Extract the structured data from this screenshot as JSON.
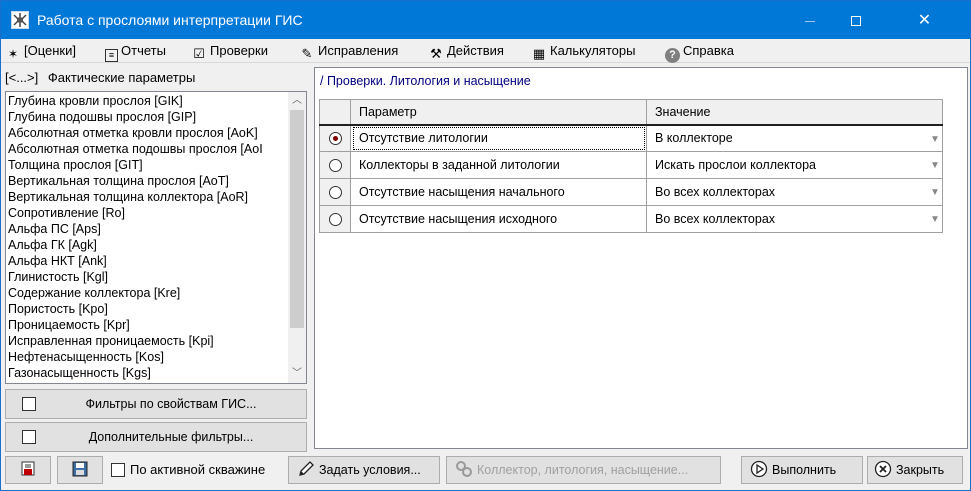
{
  "window": {
    "title": "Работа с прослоями интерпретации ГИС",
    "minimize_glyph": "—",
    "close_glyph": "✕"
  },
  "menu": [
    {
      "label": "[Оценки]",
      "icon": "running-man-icon",
      "glyph": "🏃"
    },
    {
      "label": "Отчеты",
      "icon": "report-icon",
      "glyph": "▤"
    },
    {
      "label": "Проверки",
      "icon": "checklist-icon",
      "glyph": "☑"
    },
    {
      "label": "Исправления",
      "icon": "edit-icon",
      "glyph": "✎"
    },
    {
      "label": "Действия",
      "icon": "hammer-icon",
      "glyph": "⚒"
    },
    {
      "label": "Калькуляторы",
      "icon": "calculator-icon",
      "glyph": "▦"
    },
    {
      "label": "Справка",
      "icon": "help-icon",
      "glyph": "?"
    }
  ],
  "left_panel": {
    "nav_label": "[<...>]",
    "header": "Фактические параметры",
    "params": [
      "Глубина кровли прослоя [GIK]",
      "Глубина подошвы прослоя [GIP]",
      "Абсолютная отметка кровли прослоя [AoK]",
      "Абсолютная отметка подошвы прослоя [AoI",
      "Толщина прослоя [GIT]",
      "Вертикальная толщина прослоя [AoT]",
      "Вертикальная толщина коллектора [AoR]",
      "Сопротивление [Ro]",
      "Альфа ПС [Aps]",
      "Альфа ГК [Agk]",
      "Альфа НКТ [Ank]",
      "Глинистость [Kgl]",
      "Содержание коллектора [Kre]",
      "Пористость [Kpo]",
      "Проницаемость [Kpr]",
      "Исправленная проницаемость [Kpi]",
      "Нефтенасыщенность [Kos]",
      "Газонасыщенность [Kgs]"
    ],
    "filter_gis_button": "Фильтры по свойствам ГИС...",
    "extra_filters_button": "Дополнительные фильтры..."
  },
  "main": {
    "caption": "/ Проверки. Литология и насыщение",
    "columns": [
      "Параметр",
      "Значение"
    ],
    "rows": [
      {
        "selected": true,
        "param": "Отсутствие литологии",
        "value": "В коллекторе"
      },
      {
        "selected": false,
        "param": "Коллекторы в заданной литологии",
        "value": "Искать прослои коллектора"
      },
      {
        "selected": false,
        "param": "Отсутствие насыщения начального",
        "value": "Во всех коллекторах"
      },
      {
        "selected": false,
        "param": "Отсутствие насыщения исходного",
        "value": "Во всех коллекторах"
      }
    ]
  },
  "bottom": {
    "active_well_label": "По активной скважине",
    "set_conditions_button": "Задать условия...",
    "collector_button": "Коллектор, литология, насыщение...",
    "run_button": "Выполнить",
    "close_button": "Закрыть"
  },
  "colors": {
    "titlebar": "#0078d7",
    "caption_text": "#00007f",
    "radio_checked": "#800000"
  }
}
